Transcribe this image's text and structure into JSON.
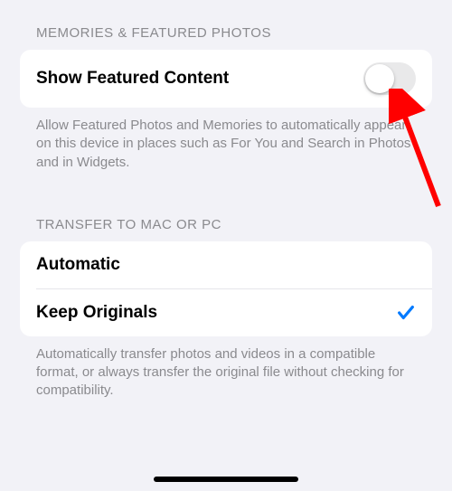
{
  "section1": {
    "header": "MEMORIES & FEATURED PHOTOS",
    "row": {
      "label": "Show Featured Content",
      "switch_on": false
    },
    "footer": "Allow Featured Photos and Memories to automatically appear on this device in places such as For You and Search in Photos and in Widgets."
  },
  "section2": {
    "header": "TRANSFER TO MAC OR PC",
    "rows": [
      {
        "label": "Automatic",
        "selected": false
      },
      {
        "label": "Keep Originals",
        "selected": true
      }
    ],
    "footer": "Automatically transfer photos and videos in a compatible format, or always transfer the original file without checking for compatibility."
  },
  "annotation": {
    "arrow_color": "#ff0000"
  }
}
